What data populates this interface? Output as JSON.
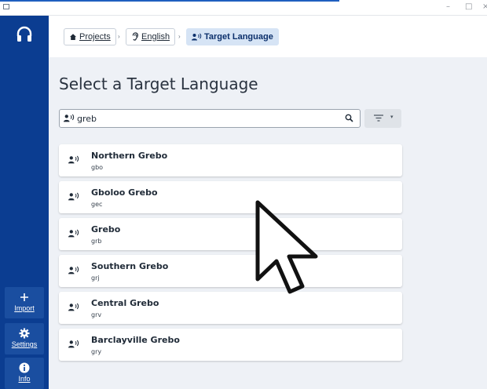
{
  "window": {
    "minimize_glyph": "–",
    "maximize_glyph": "□",
    "close_glyph": "×"
  },
  "sidebar": {
    "logo_icon": "headphones-icon",
    "buttons": [
      {
        "label": "Import",
        "icon": "plus-icon"
      },
      {
        "label": "Settings",
        "icon": "gear-icon"
      },
      {
        "label": "Info",
        "icon": "info-icon"
      }
    ]
  },
  "breadcrumb": {
    "items": [
      {
        "label": "Projects",
        "icon": "home-icon"
      },
      {
        "label": "English",
        "icon": "ear-icon"
      },
      {
        "label": "Target Language",
        "icon": "speaker-icon"
      }
    ],
    "separator": "›"
  },
  "main": {
    "title": "Select a Target Language",
    "search": {
      "value": "greb",
      "placeholder": ""
    },
    "languages": [
      {
        "name": "Northern Grebo",
        "code": "gbo"
      },
      {
        "name": "Gboloo Grebo",
        "code": "gec"
      },
      {
        "name": "Grebo",
        "code": "grb"
      },
      {
        "name": "Southern Grebo",
        "code": "grj"
      },
      {
        "name": "Central Grebo",
        "code": "grv"
      },
      {
        "name": "Barclayville Grebo",
        "code": "gry"
      }
    ]
  },
  "colors": {
    "sidebar": "#0b3d91",
    "sidebar_button": "#1a4ea0",
    "active_crumb": "#d6e4f5",
    "background": "#eef1f6"
  }
}
